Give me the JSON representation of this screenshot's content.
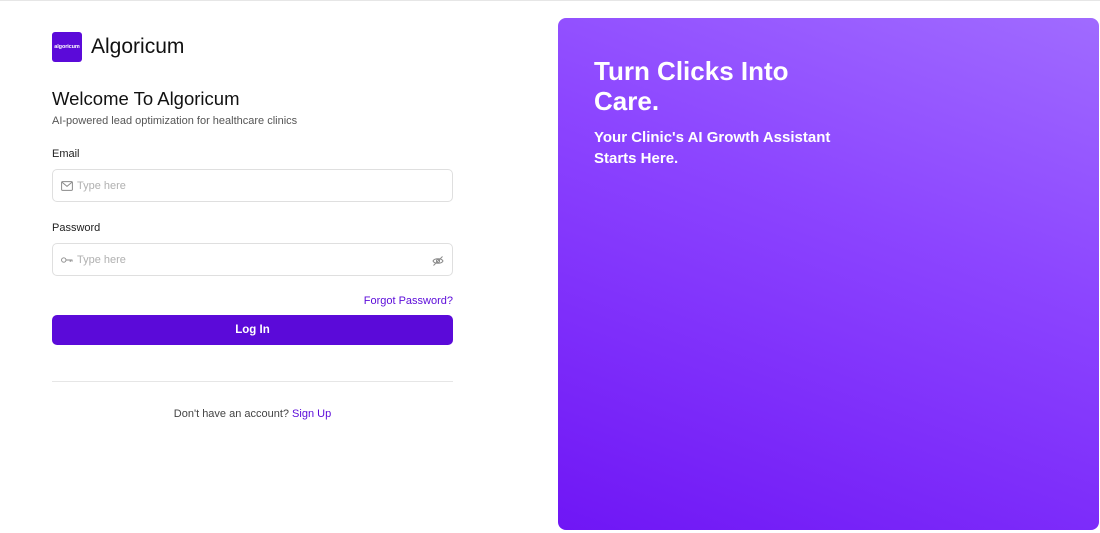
{
  "brand": {
    "logo_text": "algoricum",
    "name": "Algoricum",
    "accent_color": "#5b0ad9"
  },
  "form": {
    "title": "Welcome To Algoricum",
    "subtitle": "AI-powered lead optimization for healthcare clinics",
    "email": {
      "label": "Email",
      "placeholder": "Type here",
      "value": "",
      "icon": "mail-icon"
    },
    "password": {
      "label": "Password",
      "placeholder": "Type here",
      "value": "",
      "icon": "key-icon",
      "toggle_icon": "eye-off-icon"
    },
    "forgot_label": "Forgot Password?",
    "login_label": "Log In",
    "signup_prompt": "Don't have an account?",
    "signup_label": "Sign Up"
  },
  "hero": {
    "title": "Turn Clicks Into Care.",
    "subtitle": "Your Clinic's AI Growth Assistant Starts Here.",
    "gradient_start": "#a06bff",
    "gradient_end": "#6f16f5"
  }
}
